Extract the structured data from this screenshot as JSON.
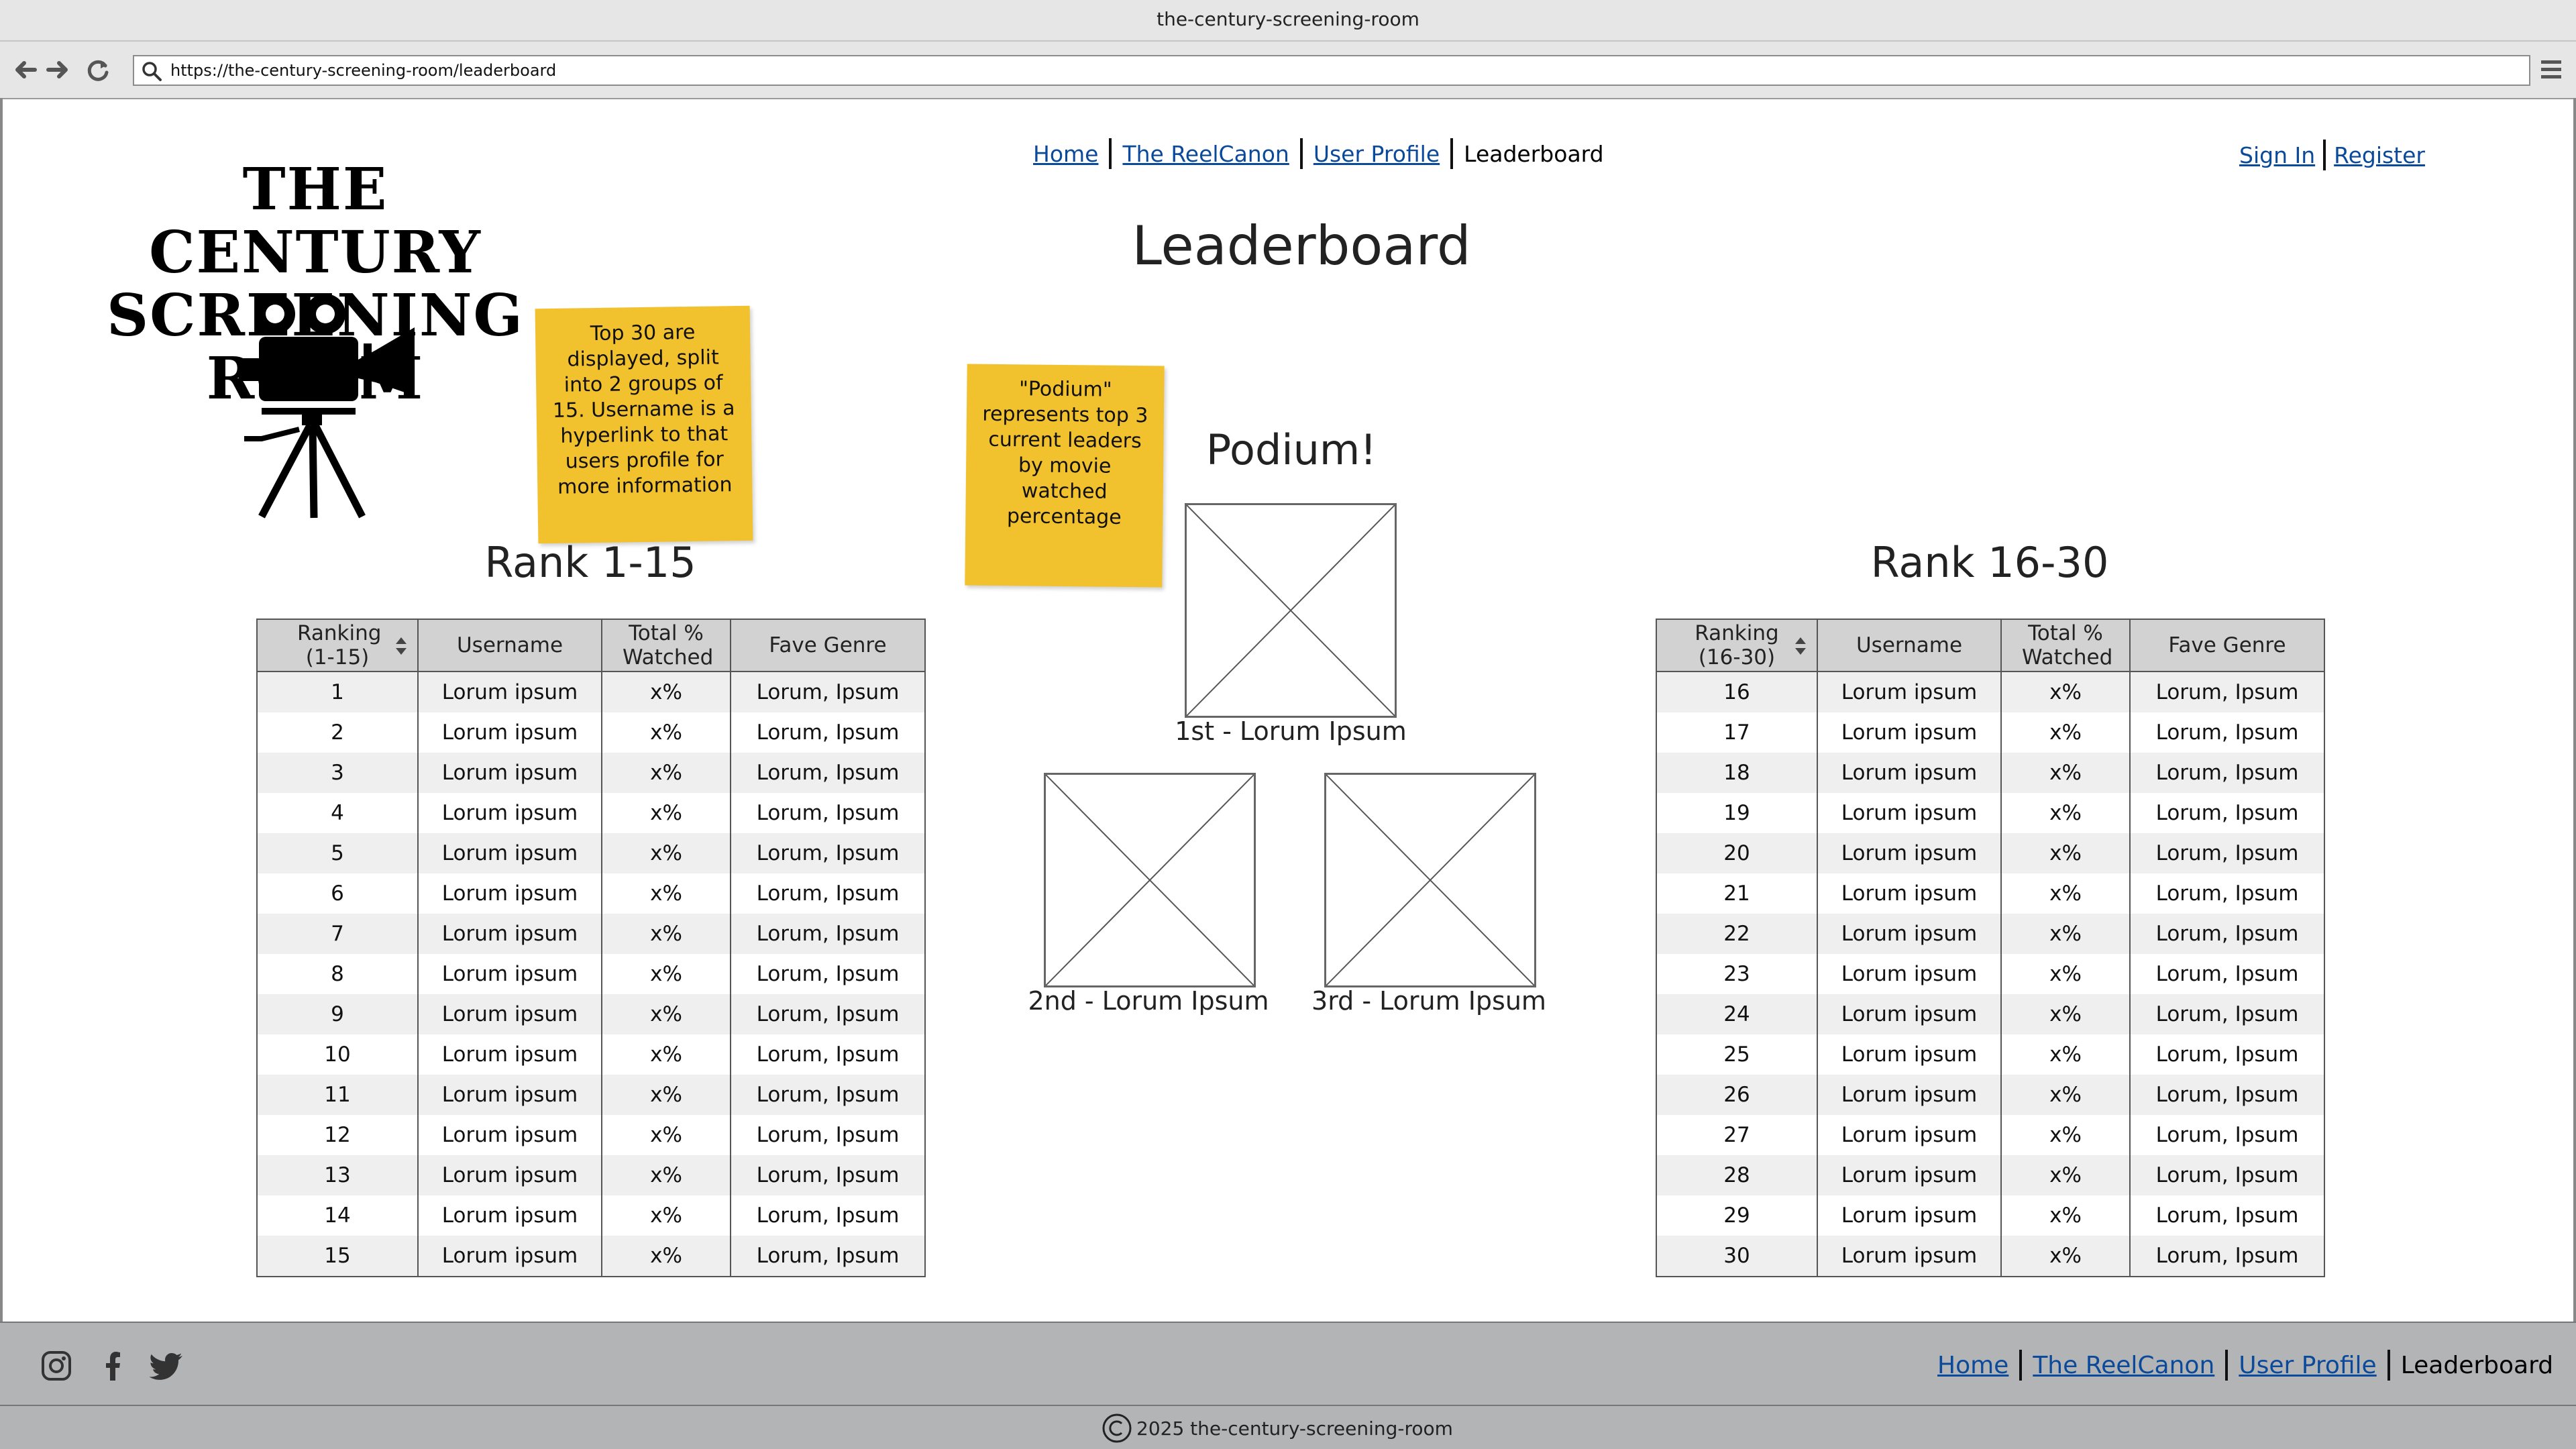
{
  "browser": {
    "title": "the-century-screening-room",
    "url": "https://the-century-screening-room/leaderboard",
    "back_icon": "back-arrow-icon",
    "forward_icon": "forward-arrow-icon",
    "reload_icon": "reload-icon",
    "menu_icon": "hamburger-menu-icon"
  },
  "header": {
    "logo_line1": "THE CENTURY",
    "logo_line2": "SCREENING",
    "logo_line3": "ROOM",
    "nav": [
      "Home",
      "The ReelCanon",
      "User Profile",
      "Leaderboard"
    ],
    "auth": [
      "Sign In",
      "Register"
    ]
  },
  "page_title": "Leaderboard",
  "notes": {
    "tables_note": "Top 30 are displayed, split into 2 groups of 15. Username is a hyperlink to that users profile for more information",
    "podium_note": "\"Podium\" represents top 3 current leaders by movie watched percentage"
  },
  "left_table": {
    "title": "Rank 1-15",
    "headers": [
      "Ranking (1-15)",
      "Username",
      "Total % Watched",
      "Fave Genre"
    ],
    "rows": [
      [
        "1",
        "Lorum ipsum",
        "x%",
        "Lorum, Ipsum"
      ],
      [
        "2",
        "Lorum ipsum",
        "x%",
        "Lorum, Ipsum"
      ],
      [
        "3",
        "Lorum ipsum",
        "x%",
        "Lorum, Ipsum"
      ],
      [
        "4",
        "Lorum ipsum",
        "x%",
        "Lorum, Ipsum"
      ],
      [
        "5",
        "Lorum ipsum",
        "x%",
        "Lorum, Ipsum"
      ],
      [
        "6",
        "Lorum ipsum",
        "x%",
        "Lorum, Ipsum"
      ],
      [
        "7",
        "Lorum ipsum",
        "x%",
        "Lorum, Ipsum"
      ],
      [
        "8",
        "Lorum ipsum",
        "x%",
        "Lorum, Ipsum"
      ],
      [
        "9",
        "Lorum ipsum",
        "x%",
        "Lorum, Ipsum"
      ],
      [
        "10",
        "Lorum ipsum",
        "x%",
        "Lorum, Ipsum"
      ],
      [
        "11",
        "Lorum ipsum",
        "x%",
        "Lorum, Ipsum"
      ],
      [
        "12",
        "Lorum ipsum",
        "x%",
        "Lorum, Ipsum"
      ],
      [
        "13",
        "Lorum ipsum",
        "x%",
        "Lorum, Ipsum"
      ],
      [
        "14",
        "Lorum ipsum",
        "x%",
        "Lorum, Ipsum"
      ],
      [
        "15",
        "Lorum ipsum",
        "x%",
        "Lorum, Ipsum"
      ]
    ]
  },
  "right_table": {
    "title": "Rank 16-30",
    "headers": [
      "Ranking (16-30)",
      "Username",
      "Total % Watched",
      "Fave Genre"
    ],
    "rows": [
      [
        "16",
        "Lorum ipsum",
        "x%",
        "Lorum, Ipsum"
      ],
      [
        "17",
        "Lorum ipsum",
        "x%",
        "Lorum, Ipsum"
      ],
      [
        "18",
        "Lorum ipsum",
        "x%",
        "Lorum, Ipsum"
      ],
      [
        "19",
        "Lorum ipsum",
        "x%",
        "Lorum, Ipsum"
      ],
      [
        "20",
        "Lorum ipsum",
        "x%",
        "Lorum, Ipsum"
      ],
      [
        "21",
        "Lorum ipsum",
        "x%",
        "Lorum, Ipsum"
      ],
      [
        "22",
        "Lorum ipsum",
        "x%",
        "Lorum, Ipsum"
      ],
      [
        "23",
        "Lorum ipsum",
        "x%",
        "Lorum, Ipsum"
      ],
      [
        "24",
        "Lorum ipsum",
        "x%",
        "Lorum, Ipsum"
      ],
      [
        "25",
        "Lorum ipsum",
        "x%",
        "Lorum, Ipsum"
      ],
      [
        "26",
        "Lorum ipsum",
        "x%",
        "Lorum, Ipsum"
      ],
      [
        "27",
        "Lorum ipsum",
        "x%",
        "Lorum, Ipsum"
      ],
      [
        "28",
        "Lorum ipsum",
        "x%",
        "Lorum, Ipsum"
      ],
      [
        "29",
        "Lorum ipsum",
        "x%",
        "Lorum, Ipsum"
      ],
      [
        "30",
        "Lorum ipsum",
        "x%",
        "Lorum, Ipsum"
      ]
    ]
  },
  "podium": {
    "title": "Podium!",
    "first": "1st - Lorum Ipsum",
    "second": "2nd - Lorum Ipsum",
    "third": "3rd - Lorum Ipsum"
  },
  "footer": {
    "social_icons": [
      "instagram-icon",
      "facebook-icon",
      "twitter-icon"
    ],
    "nav": [
      "Home",
      "The ReelCanon",
      "User Profile",
      "Leaderboard"
    ],
    "copyright": "2025 the-century-screening-room"
  },
  "colors": {
    "sticky_note": "#f2c12e",
    "link": "#0b4a9b",
    "footer_bg": "#b3b4b6",
    "table_header_bg": "#d2d2d2",
    "table_stripe": "#efefef"
  }
}
